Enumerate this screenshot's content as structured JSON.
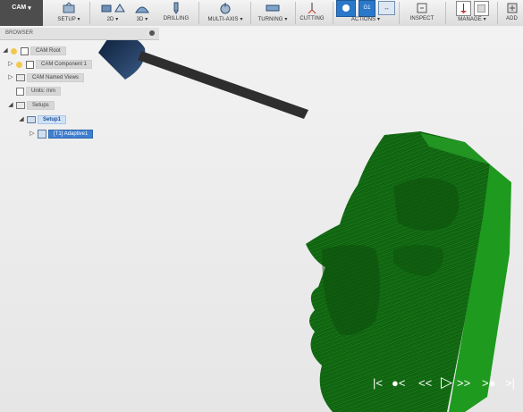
{
  "workspace": {
    "label": "CAM"
  },
  "toolbar": {
    "setup": "SETUP",
    "d2": "2D",
    "d3": "3D",
    "drilling": "DRILLING",
    "multiaxis": "MULTI-AXIS",
    "turning": "TURNING",
    "cutting": "CUTTING",
    "actions": "ACTIONS",
    "inspect": "INSPECT",
    "manage": "MANAGE",
    "addins": "ADD"
  },
  "browser": {
    "title": "BROWSER",
    "nodes": {
      "cam_root": "CAM Root",
      "cam_component": "CAM Component 1",
      "named_views": "CAM Named Views",
      "units": "Units: mm",
      "setups": "Setups",
      "setup1": "Setup1",
      "adaptive": "[T1] Adaptive1"
    }
  },
  "colors": {
    "part": "#1e7a1e",
    "selection": "#3f7fd1",
    "toolbar_active": "#2a78c9"
  },
  "playback": {
    "icons": [
      "skip-start-icon",
      "step-back-icon",
      "rewind-icon",
      "play-icon",
      "fast-forward-icon",
      "step-forward-icon",
      "skip-end-icon"
    ]
  }
}
